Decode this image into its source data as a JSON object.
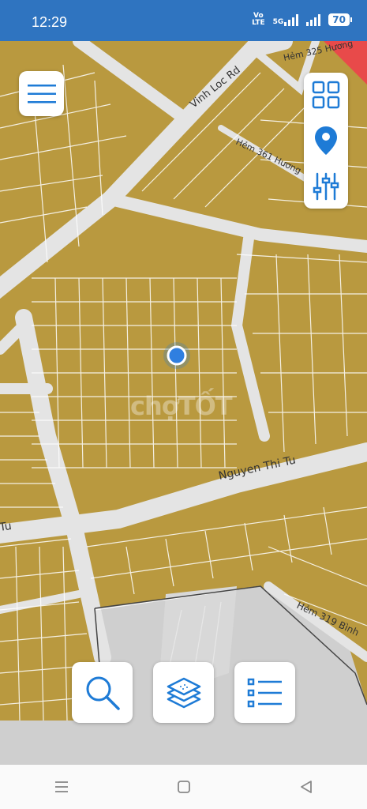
{
  "status": {
    "time": "12:29",
    "network": "5G",
    "volte_top": "Vo",
    "volte_bottom": "LTE",
    "battery": "70"
  },
  "map": {
    "roads": {
      "vinh_loc": "Vinh Loc Rd",
      "hem_325": "Hẻm 325 Hương",
      "hem_361": "Hẻm 361 Hương",
      "nguyen_thi_tu": "Nguyen Thi Tu",
      "left_fragment": "Tu",
      "hem_319": "Hẻm 319 Bình"
    },
    "watermark": "chợTỐT",
    "colors": {
      "parcel": "#b9993f",
      "road": "#e4e4e4",
      "blank_area": "#cfcfcf",
      "alert": "#e84a4a",
      "accent": "#1e7bd6"
    }
  },
  "icons": {
    "menu": "hamburger-icon",
    "grid": "grid-icon",
    "location": "location-pin-icon",
    "filters": "sliders-icon",
    "search": "search-icon",
    "layers": "layers-icon",
    "list": "list-icon"
  }
}
